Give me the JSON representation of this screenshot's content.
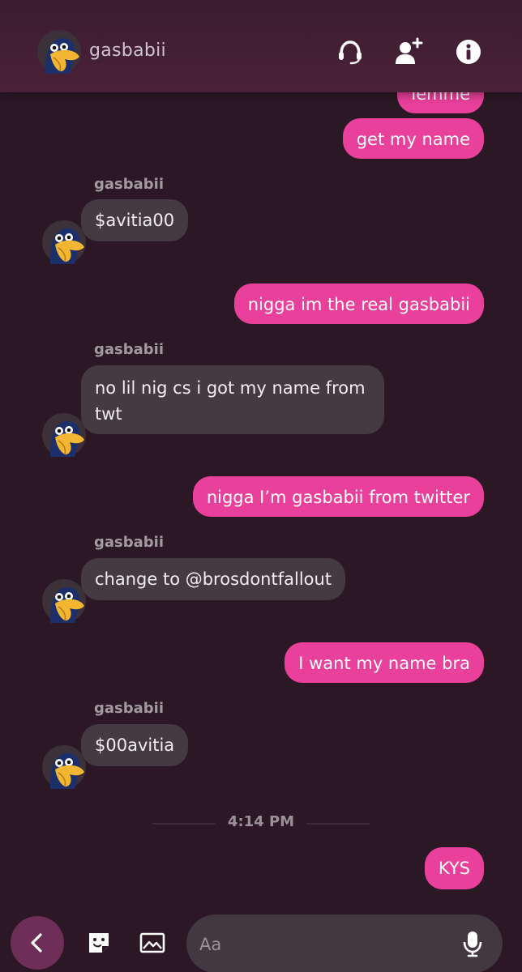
{
  "header": {
    "contact_name": "gasbabii",
    "icons": [
      "headset-icon",
      "add-user-icon",
      "info-icon"
    ]
  },
  "colors": {
    "outgoing_bubble": "#e8409b",
    "incoming_bubble": "#453a41",
    "background": "#2b1824",
    "header": "#4a2138",
    "back_button": "#6d2f57"
  },
  "messages": [
    {
      "direction": "out",
      "text": "lemme"
    },
    {
      "direction": "out",
      "text": "get my name"
    },
    {
      "direction": "in",
      "sender": "gasbabii",
      "text": "$avitia00"
    },
    {
      "direction": "out",
      "text": "nigga im the real gasbabii"
    },
    {
      "direction": "in",
      "sender": "gasbabii",
      "text_line1": "no lil nig cs i got my name from",
      "text_line2": "twt"
    },
    {
      "direction": "out",
      "text": "nigga I’m gasbabii from twitter"
    },
    {
      "direction": "in",
      "sender": "gasbabii",
      "text": "change to @brosdontfallout"
    },
    {
      "direction": "out",
      "text": "I want my name bra"
    },
    {
      "direction": "in",
      "sender": "gasbabii",
      "text": "$00avitia"
    },
    {
      "direction": "out",
      "text": "KYS"
    }
  ],
  "divider": {
    "time": "4:14 PM"
  },
  "composer": {
    "placeholder": "Aa",
    "icons": [
      "back-arrow-icon",
      "sticker-icon",
      "image-icon",
      "microphone-icon"
    ]
  }
}
